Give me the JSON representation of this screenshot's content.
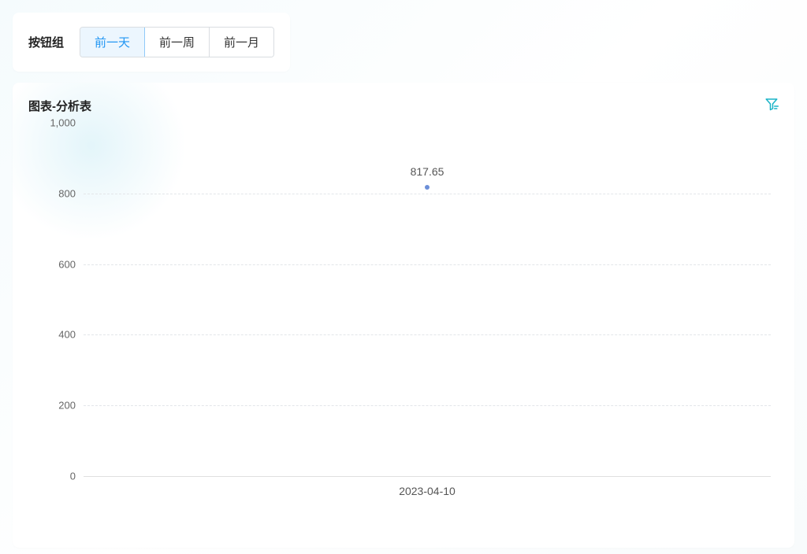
{
  "button_group": {
    "label": "按钮组",
    "options": [
      {
        "key": "prev-day",
        "label": "前一天",
        "active": true
      },
      {
        "key": "prev-week",
        "label": "前一周",
        "active": false
      },
      {
        "key": "prev-month",
        "label": "前一月",
        "active": false
      }
    ]
  },
  "chart_panel": {
    "title": "图表-分析表"
  },
  "chart_data": {
    "type": "scatter",
    "title": "图表-分析表",
    "categories": [
      "2023-04-10"
    ],
    "series": [
      {
        "name": "",
        "values": [
          817.65
        ]
      }
    ],
    "xlabel": "",
    "ylabel": "",
    "ylim": [
      0,
      1000
    ],
    "y_ticks": [
      0,
      200,
      400,
      600,
      800,
      1000
    ],
    "y_tick_labels": [
      "0",
      "200",
      "400",
      "600",
      "800",
      "1,000"
    ],
    "grid": true,
    "show_point_labels": true
  }
}
